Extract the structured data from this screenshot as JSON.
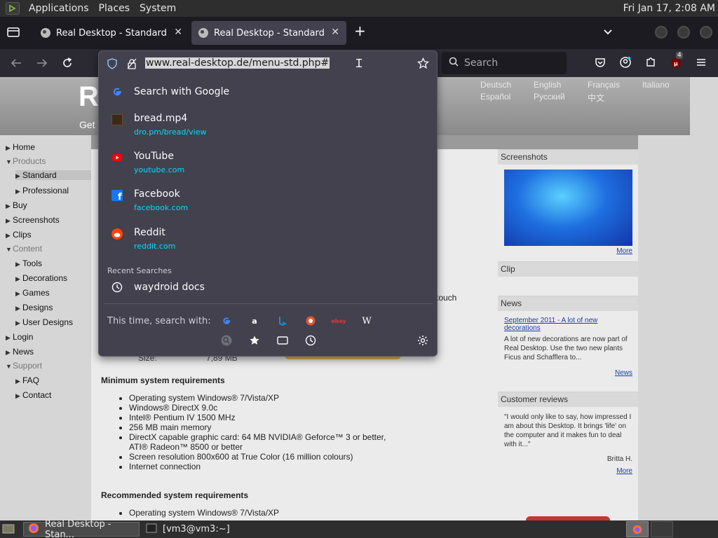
{
  "system_panel": {
    "menus": [
      "Applications",
      "Places",
      "System"
    ],
    "clock": "Fri Jan 17,  2:08 AM"
  },
  "tabs": [
    {
      "label": "Real Desktop - Standard"
    },
    {
      "label": "Real Desktop - Standard"
    }
  ],
  "toolbar": {
    "search_placeholder": "Search",
    "extensions_badge": "4"
  },
  "urlbar": {
    "url": "www.real-desktop.de/menu-std.php#",
    "results": [
      {
        "title": "Search with Google",
        "sub": "",
        "icon": "google-icon"
      },
      {
        "title": "bread.mp4",
        "sub": "dro.pm/bread/view",
        "icon": "video-thumb-icon"
      },
      {
        "title": "YouTube",
        "sub": "youtube.com",
        "icon": "youtube-icon"
      },
      {
        "title": "Facebook",
        "sub": "facebook.com",
        "icon": "facebook-icon"
      },
      {
        "title": "Reddit",
        "sub": "reddit.com",
        "icon": "reddit-icon"
      }
    ],
    "recent_header": "Recent Searches",
    "recent": [
      {
        "title": "waydroid docs"
      }
    ],
    "search_with_label": "This time, search with:"
  },
  "webpage": {
    "header_letter": "R",
    "header_sub": "Get",
    "languages": [
      "Deutsch",
      "English",
      "Français",
      "Italiano",
      "Español",
      "Русский",
      "中文"
    ],
    "nav_items": [
      "Home",
      "Products",
      "Standard",
      "Professional",
      "Buy",
      "Screenshots",
      "Clips",
      "Content",
      "Tools",
      "Decorations",
      "Games",
      "Designs",
      "User Designs",
      "Login",
      "News",
      "Support",
      "FAQ",
      "Contact"
    ],
    "partial_text": "touch",
    "size_label": "Size:",
    "size_value": "7,89 MB",
    "min_req_title": "Minimum system requirements",
    "min_req": [
      "Operating system Windows® 7/Vista/XP",
      "Windows® DirectX 9.0c",
      "Intel® Pentium IV 1500 MHz",
      "256 MB main memory",
      "DirectX capable graphic card: 64 MB NVIDIA® Geforce™ 3 or better, ATI® Radeon™ 8500 or better",
      "Screen resolution 800x600 at True Color (16 million colours)",
      "Internet connection"
    ],
    "rec_req_title": "Recommended system requirements",
    "rec_req": [
      "Operating system Windows® 7/Vista/XP"
    ],
    "right": {
      "screenshots_title": "Screenshots",
      "more_label": "More",
      "clip_title": "Clip",
      "news_title": "News",
      "news_link": "September 2011 - A lot of new decorations",
      "news_body": "A lot of new decorations are now part of Real Desktop. Use the two new plants Ficus and Schafflera to...",
      "news_more": "News",
      "reviews_title": "Customer reviews",
      "review_text": "\"I would only like to say, how impressed I am about this Desktop. It brings 'life' on the computer and it makes fun to deal with it...\"",
      "review_author": "Britta H.",
      "reviews_more": "More"
    }
  },
  "taskbar": {
    "items": [
      "Real Desktop - Stan...",
      "[vm3@vm3:~]"
    ]
  }
}
